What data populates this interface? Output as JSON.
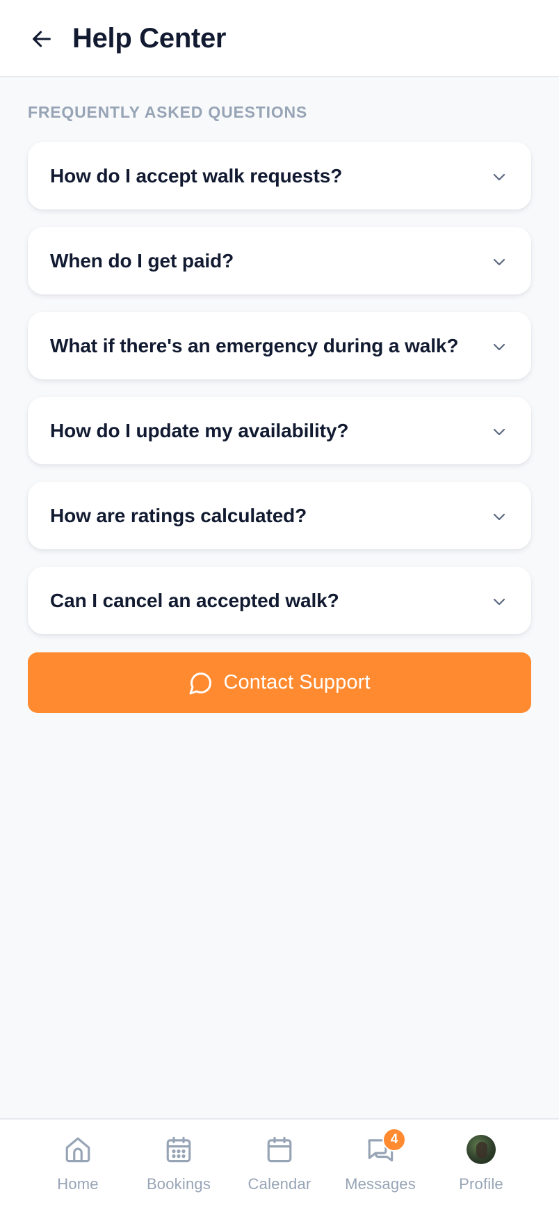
{
  "header": {
    "title": "Help Center",
    "back_icon": "arrow-left-icon"
  },
  "faq": {
    "section_label": "FREQUENTLY ASKED QUESTIONS",
    "items": [
      {
        "question": "How do I accept walk requests?"
      },
      {
        "question": "When do I get paid?"
      },
      {
        "question": "What if there's an emergency during a walk?"
      },
      {
        "question": "How do I update my availability?"
      },
      {
        "question": "How are ratings calculated?"
      },
      {
        "question": "Can I cancel an accepted walk?"
      }
    ]
  },
  "contact": {
    "label": "Contact Support",
    "icon": "chat-bubble-icon"
  },
  "nav": {
    "items": [
      {
        "label": "Home",
        "icon": "home-icon"
      },
      {
        "label": "Bookings",
        "icon": "calendar-grid-icon"
      },
      {
        "label": "Calendar",
        "icon": "calendar-icon"
      },
      {
        "label": "Messages",
        "icon": "messages-icon",
        "badge": "4"
      },
      {
        "label": "Profile",
        "icon": "avatar"
      }
    ]
  },
  "colors": {
    "accent": "#ff8a2f",
    "text_primary": "#111a30",
    "text_muted": "#97a4b6",
    "background": "#f8f9fb"
  }
}
